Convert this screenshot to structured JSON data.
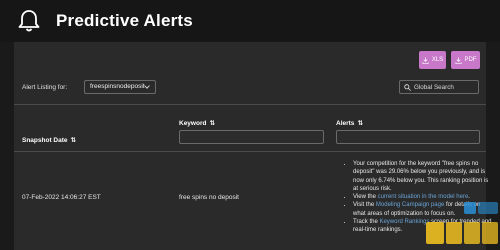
{
  "header": {
    "title": "Predictive Alerts"
  },
  "toolbar": {
    "xls_label": "XLS",
    "pdf_label": "PDF"
  },
  "filters": {
    "alert_listing_label": "Alert Listing for:",
    "alert_listing_value": "freespinsnodeposit",
    "search_placeholder": "Global Search"
  },
  "table": {
    "columns": {
      "snapshot_date": "Snapshot Date",
      "keyword": "Keyword",
      "alerts": "Alerts",
      "sort_glyph": "⇅"
    },
    "row": {
      "snapshot_date": "07-Feb-2022 14:06:27 EST",
      "keyword": "free spins no deposit",
      "alert_1": "Your competition for the keyword \"free spins no deposit\" was 29.06% below you previously, and is now only 6.74% below you. This ranking position is at serious risk.",
      "alert_2_pre": "View the ",
      "alert_2_link": "current situation in the model here",
      "alert_2_post": ".",
      "alert_3_pre": "Visit the ",
      "alert_3_link": "Modeling Campaign page",
      "alert_3_post": " for details on what areas of optimization to focus on.",
      "alert_4_pre": "Track the ",
      "alert_4_link": "Keyword Rankings",
      "alert_4_post": " screen for trended and real-time rankings."
    }
  },
  "colors": {
    "page_bg": "#1a1a1a",
    "panel_bg": "#2a2a2a",
    "button_bg": "#c778c9",
    "link": "#6aa4d6"
  },
  "icons": [
    "bell-icon",
    "download-icon",
    "chevron-down-icon",
    "search-icon",
    "sort-icon"
  ]
}
